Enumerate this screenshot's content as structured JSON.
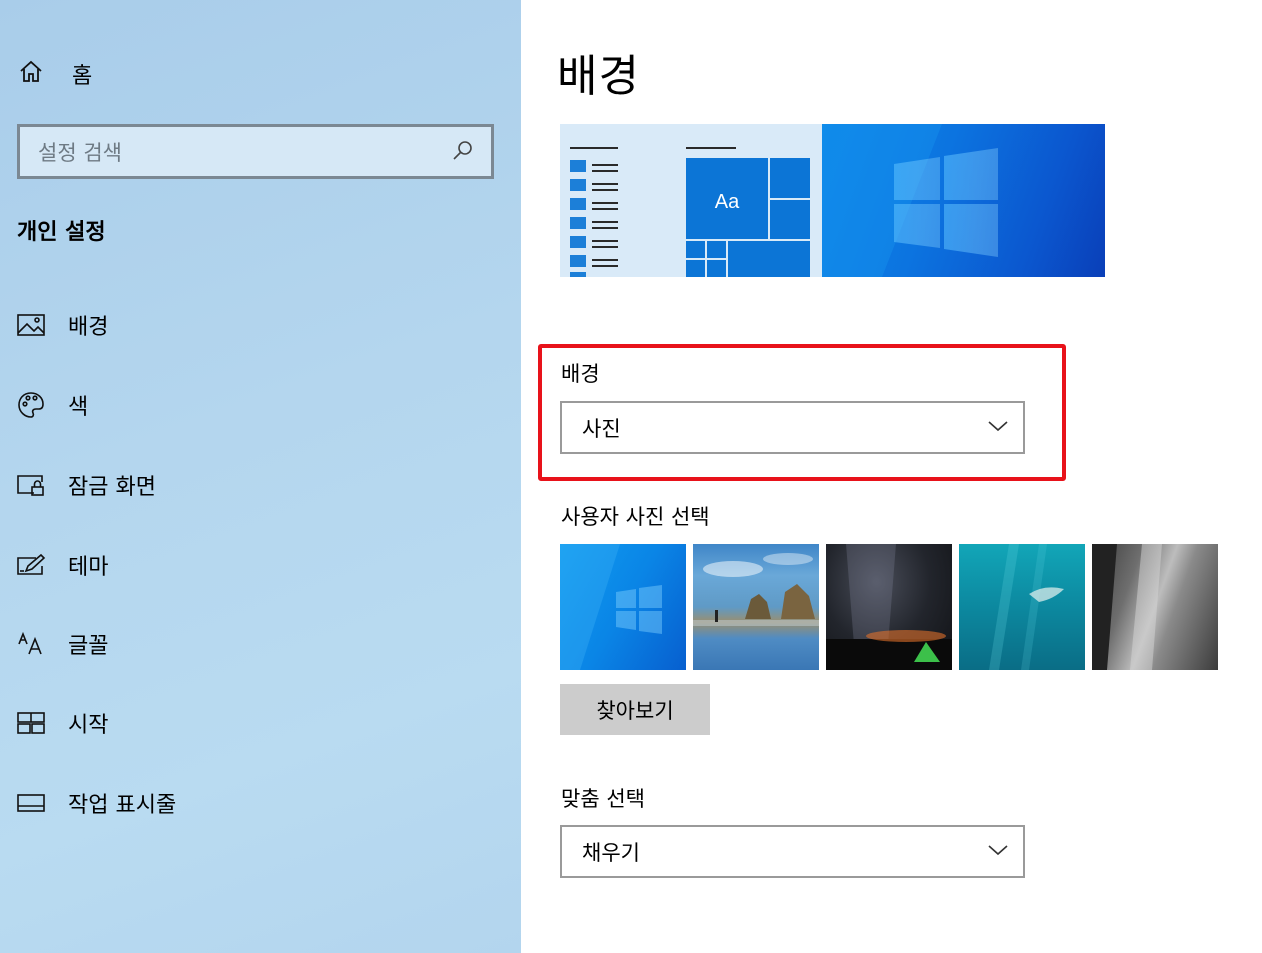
{
  "sidebar": {
    "home_label": "홈",
    "search_placeholder": "설정 검색",
    "section_title": "개인 설정",
    "items": [
      {
        "label": "배경",
        "icon": "picture-icon"
      },
      {
        "label": "색",
        "icon": "palette-icon"
      },
      {
        "label": "잠금 화면",
        "icon": "lock-screen-icon"
      },
      {
        "label": "테마",
        "icon": "theme-icon"
      },
      {
        "label": "글꼴",
        "icon": "font-icon"
      },
      {
        "label": "시작",
        "icon": "start-icon"
      },
      {
        "label": "작업 표시줄",
        "icon": "taskbar-icon"
      }
    ]
  },
  "main": {
    "title": "배경",
    "preview": {
      "tile_text": "Aa"
    },
    "background": {
      "label": "배경",
      "value": "사진"
    },
    "choose_photo": {
      "label": "사용자 사진 선택",
      "browse_label": "찾아보기"
    },
    "fit": {
      "label": "맞춤 선택",
      "value": "채우기"
    }
  },
  "colors": {
    "accent": "#0078d7",
    "highlight_border": "#e8121a",
    "sidebar_bg": "#b4d6ee"
  }
}
